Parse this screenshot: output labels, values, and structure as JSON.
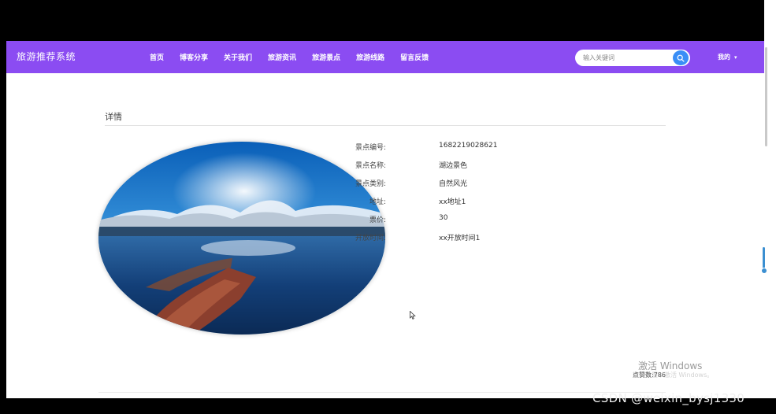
{
  "nav": {
    "brand": "旅游推荐系统",
    "items": [
      {
        "label": "首页"
      },
      {
        "label": "博客分享"
      },
      {
        "label": "关于我们"
      },
      {
        "label": "旅游资讯"
      },
      {
        "label": "旅游景点"
      },
      {
        "label": "旅游线路"
      },
      {
        "label": "留言反馈"
      }
    ],
    "search_placeholder": "输入关键词",
    "user_menu": "我的",
    "accent": "#8b4cf2"
  },
  "detail": {
    "title": "详情",
    "fields": [
      {
        "label": "景点编号:",
        "value": "1682219028621"
      },
      {
        "label": "景点名称:",
        "value": "湖边景色"
      },
      {
        "label": "景点类别:",
        "value": "自然风光"
      },
      {
        "label": "地址:",
        "value": "xx地址1"
      },
      {
        "label": "票价:",
        "value": "30"
      },
      {
        "label": "开放时间:",
        "value": "xx开放时间1"
      }
    ]
  },
  "watermark": {
    "windows_title": "激活 Windows",
    "windows_sub": "转到设置以激活 Windows。",
    "likes": "点赞数:786",
    "csdn": "CSDN @weixin_bysj1330"
  }
}
